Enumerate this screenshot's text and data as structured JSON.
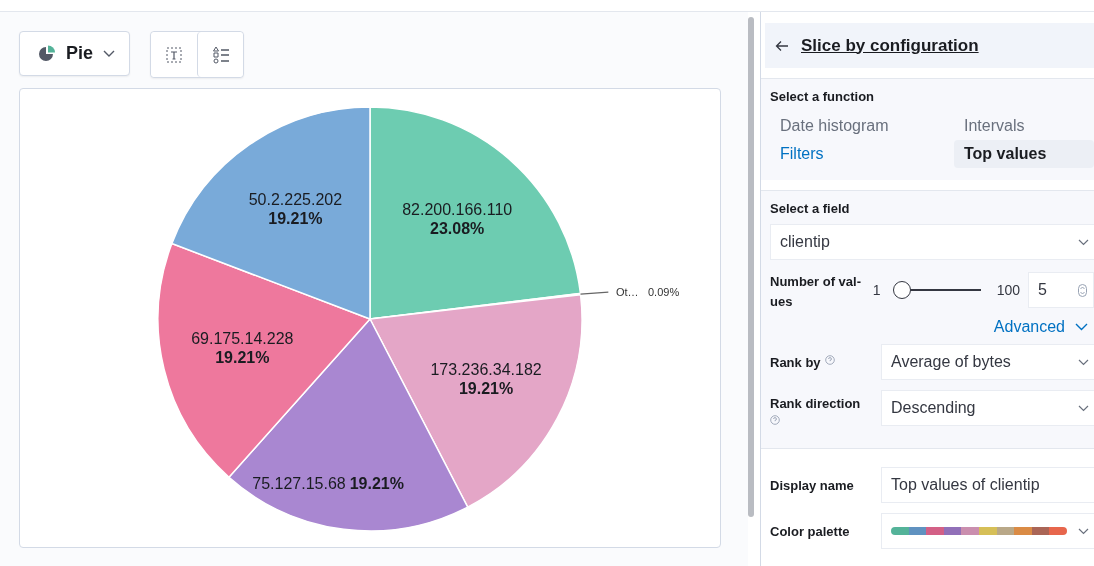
{
  "toolbar": {
    "chart_type": "Pie"
  },
  "chart": {
    "chart_data": {
      "type": "pie",
      "categories": [
        "82.200.166.110",
        "Ot…",
        "173.236.34.182",
        "75.127.15.68",
        "69.175.14.228",
        "50.2.225.202"
      ],
      "values": [
        23.08,
        0.09,
        19.21,
        19.21,
        19.21,
        19.21
      ],
      "value_labels": [
        "23.08%",
        "0.09%",
        "19.21%",
        "19.21%",
        "19.21%",
        "19.21%"
      ],
      "colors": [
        "#6dccb1",
        "#d9d9d9",
        "#e4a6c7",
        "#a987d1",
        "#ee789d",
        "#79aad9"
      ],
      "data_labels": true
    }
  },
  "panel": {
    "title": "Slice by configuration",
    "function_label": "Select a function",
    "functions": [
      {
        "label": "Date histogram",
        "selected": false,
        "disabled": true
      },
      {
        "label": "Intervals",
        "selected": false,
        "disabled": true
      },
      {
        "label": "Filters",
        "selected": false,
        "disabled": false
      },
      {
        "label": "Top values",
        "selected": true,
        "disabled": false
      }
    ],
    "field_label": "Select a field",
    "field_value": "clientip",
    "count_label": "Number of val-\nues",
    "slider_min": "1",
    "slider_max": "100",
    "slider": {
      "level": 0.04
    },
    "count_value": "5",
    "advanced": "Advanced",
    "rank_by_label": "Rank by",
    "rank_by_value": "Average of bytes",
    "rank_dir_label": "Rank direction",
    "rank_dir_value": "Descending",
    "display_name_label": "Display name",
    "display_name_value": "Top values of clientip",
    "palette_label": "Color palette",
    "palette": [
      {
        "color": "#54b399"
      },
      {
        "color": "#6092c0"
      },
      {
        "color": "#d36086"
      },
      {
        "color": "#9170b8"
      },
      {
        "color": "#ca8eae"
      },
      {
        "color": "#d6bf57"
      },
      {
        "color": "#b9a888"
      },
      {
        "color": "#da8b45"
      },
      {
        "color": "#aa6556"
      },
      {
        "color": "#e7664c"
      }
    ]
  }
}
